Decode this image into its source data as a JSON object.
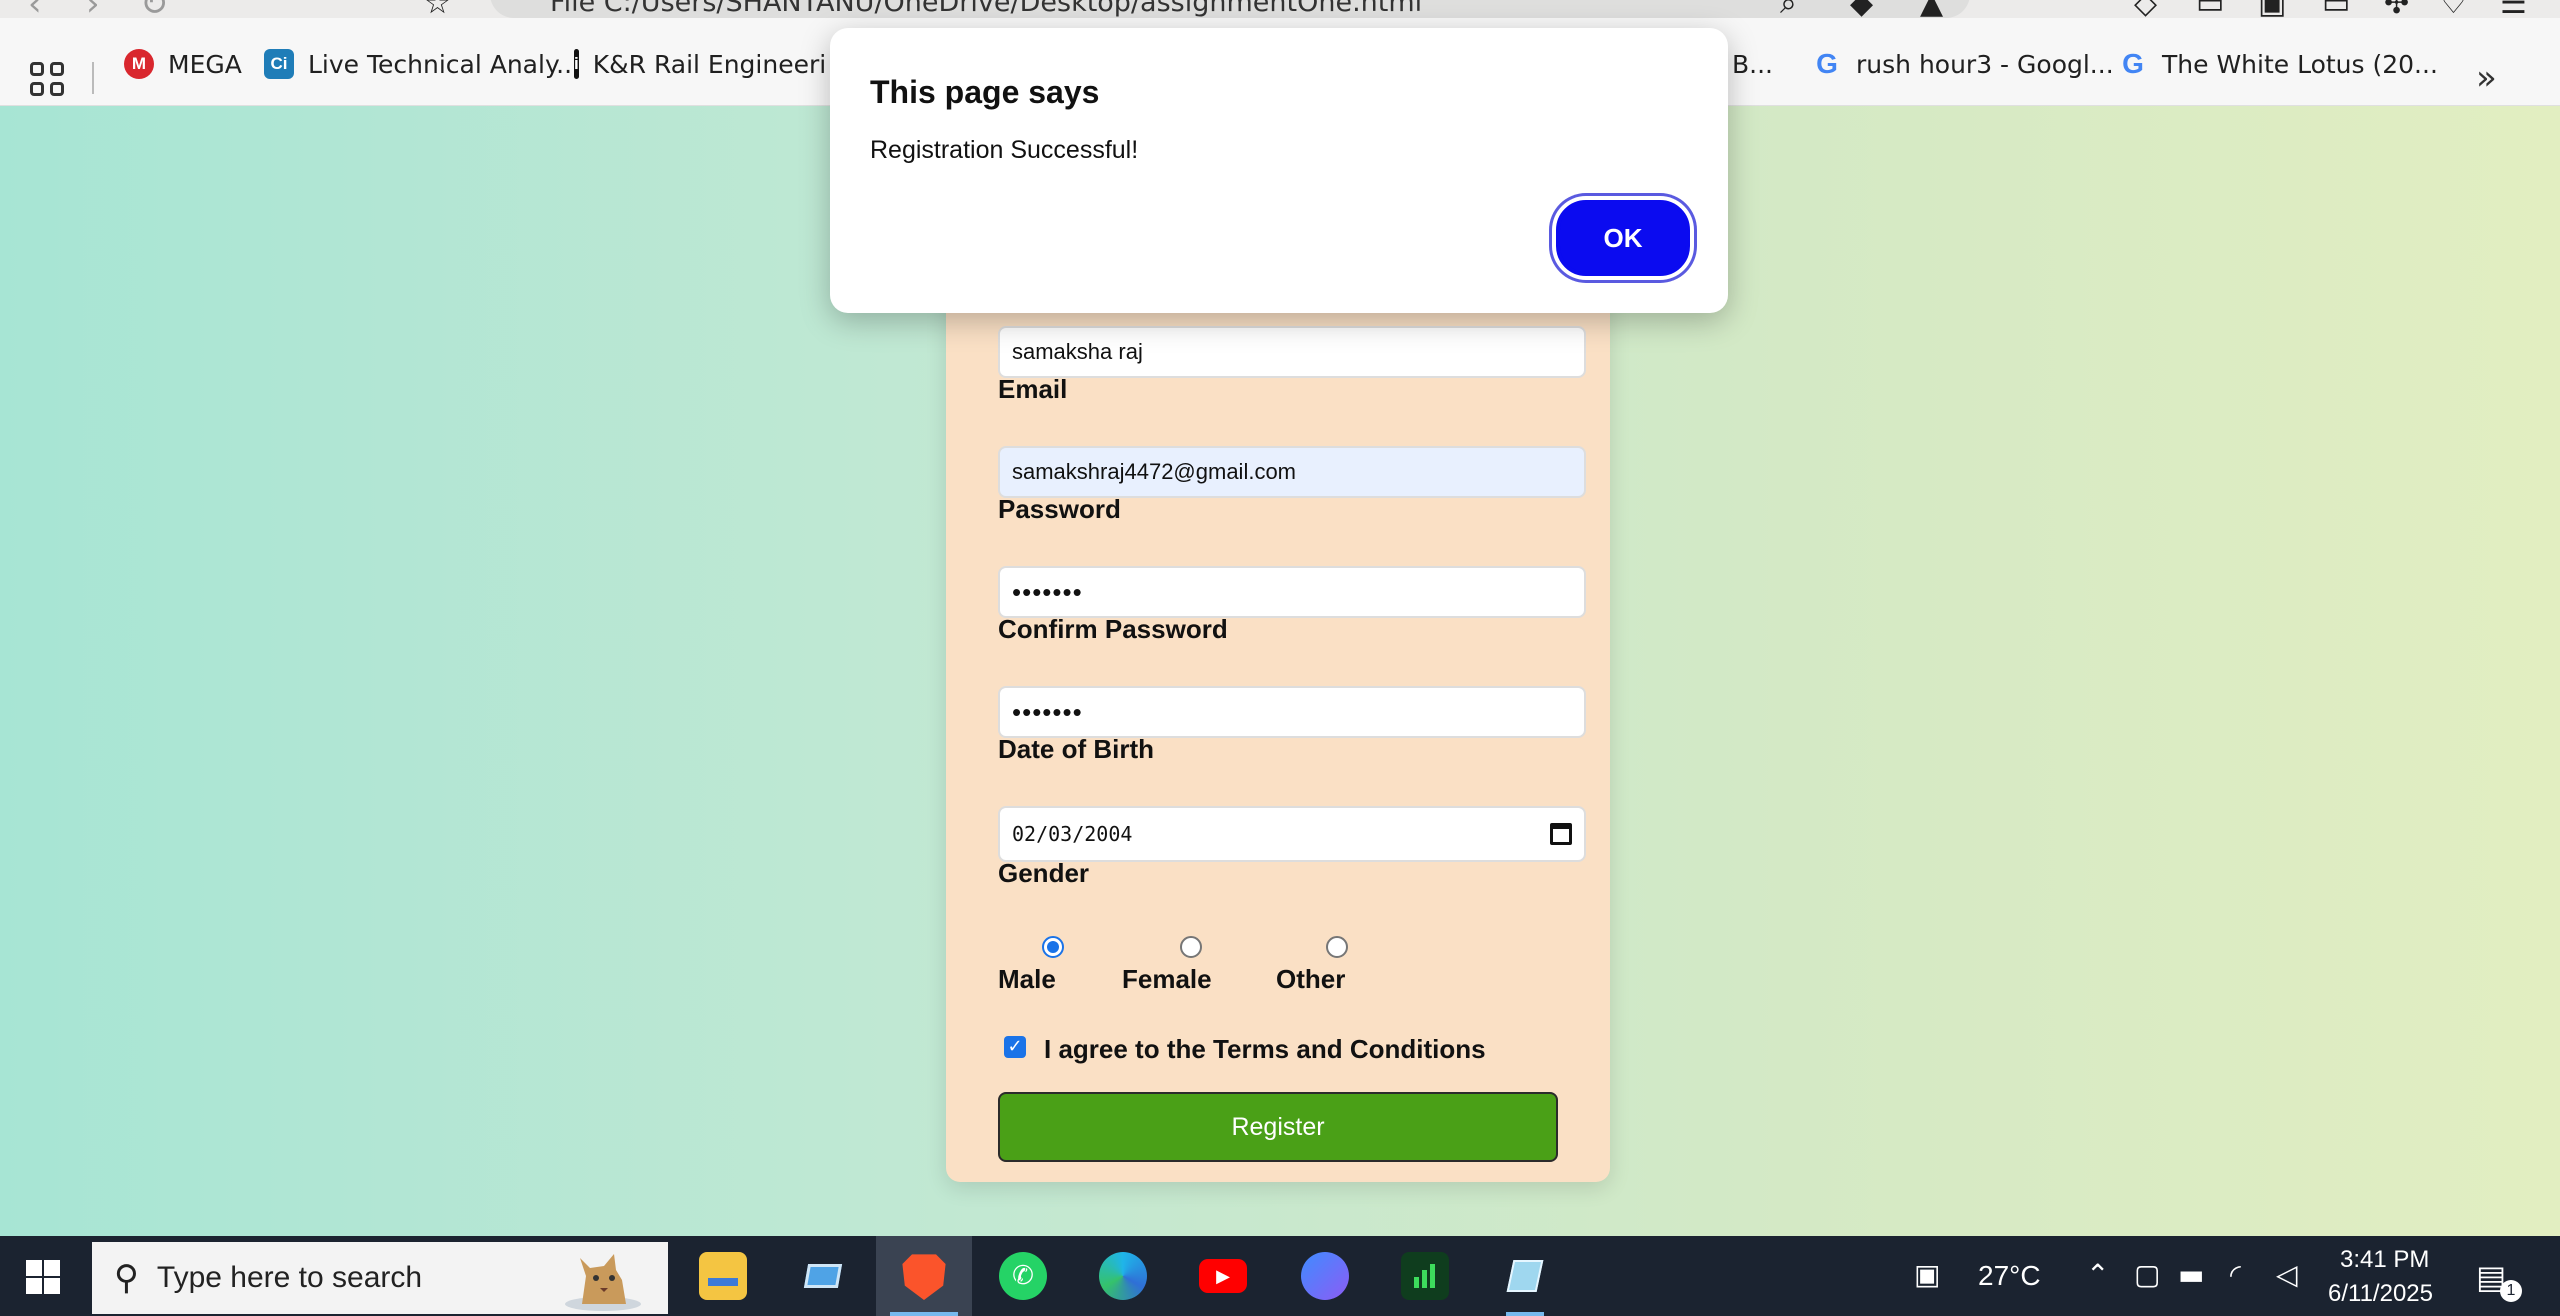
{
  "browser": {
    "url": "File   C:/Users/SHANTANU/OneDrive/Desktop/assignmentOne.html",
    "bookmarks": [
      {
        "label": "MEGA",
        "favicon": "M",
        "color": "#d9272e"
      },
      {
        "label": "Live Technical Analy...",
        "favicon": "Ci",
        "color": "#1f7db8"
      },
      {
        "label": "K&R Rail Engineerin",
        "favicon": "i",
        "color": "#111111"
      },
      {
        "label": "B...",
        "favicon": "",
        "color": ""
      },
      {
        "label": "rush hour3 - Googl...",
        "favicon": "G",
        "color": "#4285f4"
      },
      {
        "label": "The White Lotus (20...",
        "favicon": "G",
        "color": "#4285f4"
      }
    ],
    "more_bookmarks": "»"
  },
  "dialog": {
    "title": "This page says",
    "message": "Registration Successful!",
    "ok_label": "OK"
  },
  "form": {
    "name_value": "samaksha raj",
    "email_label": "Email",
    "email_value": "samakshraj4472@gmail.com",
    "password_label": "Password",
    "password_value": "•••••••",
    "confirm_label": "Confirm Password",
    "confirm_value": "•••••••",
    "dob_label": "Date of Birth",
    "dob_value": "02/03/2004",
    "gender_label": "Gender",
    "gender_options": [
      "Male",
      "Female",
      "Other"
    ],
    "gender_selected": "Male",
    "terms_label": "I agree to the Terms and Conditions",
    "terms_checked": true,
    "register_label": "Register"
  },
  "taskbar": {
    "search_placeholder": "Type here to search",
    "weather": "27°C",
    "time": "3:41 PM",
    "date": "6/11/2025",
    "notification_count": "1",
    "apps": [
      "file-explorer",
      "computer",
      "brave",
      "whatsapp",
      "edge",
      "youtube",
      "browser",
      "charts",
      "note"
    ]
  },
  "colors": {
    "accent_green": "#4aa017",
    "dialog_ok": "#0b0bf0",
    "card": "#fae0c5"
  }
}
